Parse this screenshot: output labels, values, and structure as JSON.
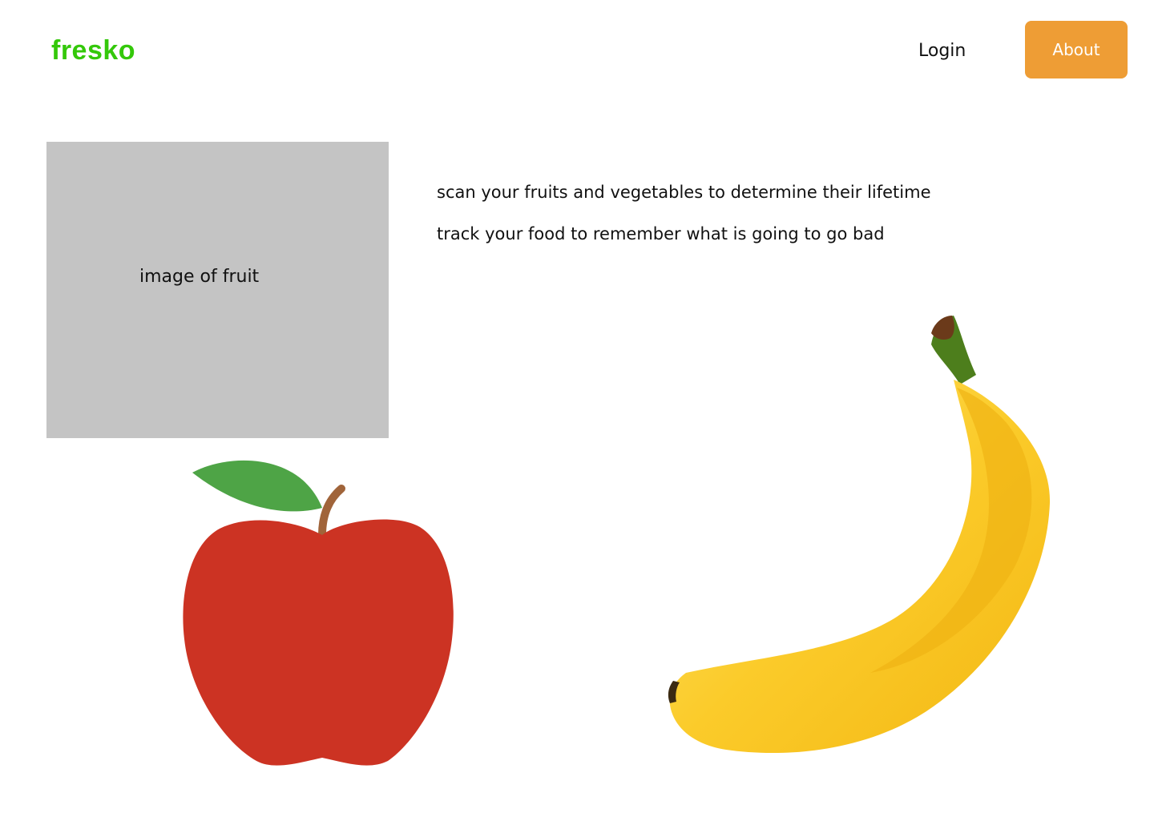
{
  "brand": {
    "name": "fresko",
    "color": "#34c80a"
  },
  "nav": {
    "login_label": "Login",
    "about_label": "About",
    "about_color": "#ee9d35"
  },
  "hero": {
    "image_placeholder_label": "image of fruit",
    "features": [
      "scan your fruits and vegetables to determine their lifetime",
      "track your food to remember what is going to go bad"
    ]
  },
  "illustrations": {
    "apple": {
      "icon": "apple-icon",
      "body_color": "#cc3323",
      "leaf_color": "#4ea446",
      "stem_color": "#a0643a"
    },
    "banana": {
      "icon": "banana-icon",
      "peel_color": "#fbcb2a",
      "shade_color": "#f0b414",
      "stem_color": "#4d7e1c"
    }
  }
}
